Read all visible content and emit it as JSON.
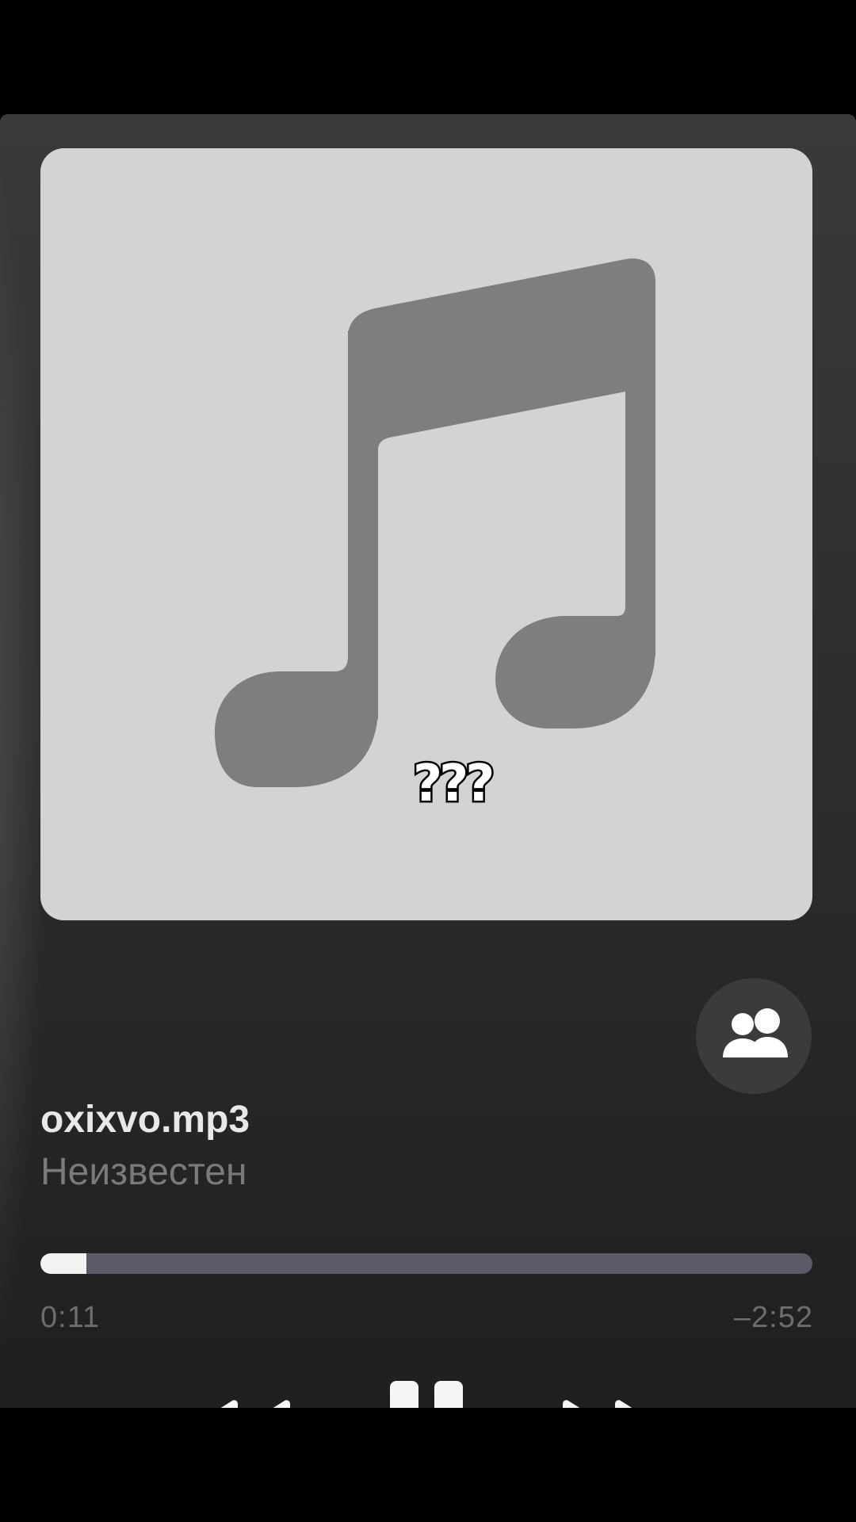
{
  "track": {
    "title": "oxixvo.mp3",
    "artist": "Неизвестен"
  },
  "artwork": {
    "icon": "music-note-icon",
    "overlay_text": "???"
  },
  "playback": {
    "elapsed": "0:11",
    "remaining": "–2:52",
    "progress_fraction": 0.06
  },
  "controls": {
    "rewind_icon": "rewind-icon",
    "pause_icon": "pause-icon",
    "forward_icon": "fast-forward-icon",
    "share_icon": "shareplay-people-icon"
  },
  "colors": {
    "progress_fill": "#f2f2f2",
    "progress_track": "#5c5a66",
    "artwork_bg": "#d3d3d3",
    "note": "#7e7e7e"
  }
}
